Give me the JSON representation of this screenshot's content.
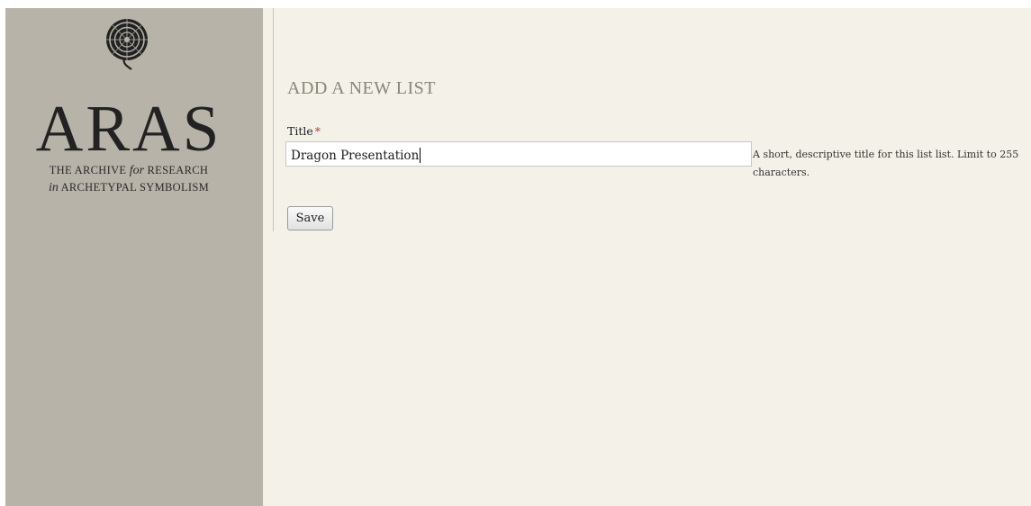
{
  "sidebar": {
    "logo": {
      "icon": "spiral-mandala-icon",
      "wordmark": "ARAS",
      "tagline_line1_pre": "THE ARCHIVE ",
      "tagline_line1_em": "for",
      "tagline_line1_post": " RESEARCH",
      "tagline_line2_em": "in",
      "tagline_line2_post": " ARCHETYPAL SYMBOLISM"
    }
  },
  "form": {
    "heading": "ADD A NEW LIST",
    "title_field": {
      "label": "Title",
      "required_marker": "*",
      "value": "Dragon Presentation",
      "description": "A short, descriptive title for this list list. Limit to 255 characters."
    },
    "save_label": "Save"
  },
  "colors": {
    "sidebar_bg": "#b7b3a8",
    "main_bg": "#f3f1e8",
    "heading": "#8a8578",
    "required": "#c0392b"
  }
}
